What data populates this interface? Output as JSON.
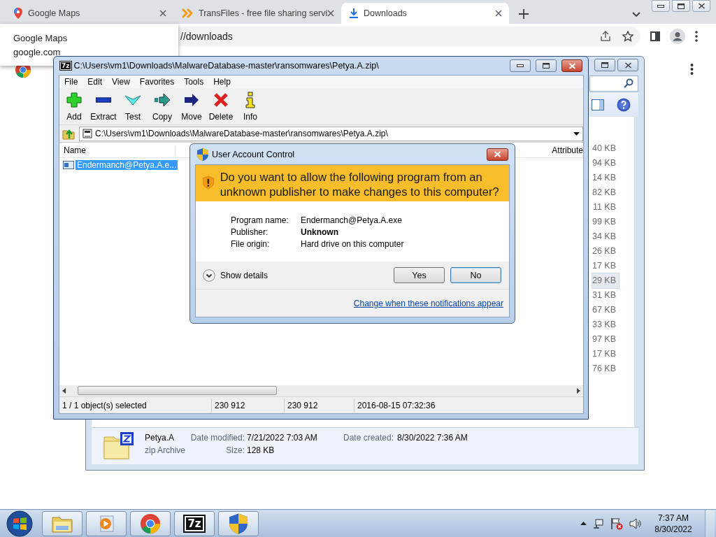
{
  "browser": {
    "tabs": [
      {
        "kind": "maps",
        "title": "Google Maps",
        "selected": false
      },
      {
        "kind": "transfer",
        "title": "TransFiles - free file sharing servi",
        "selected": false
      },
      {
        "kind": "download",
        "title": "Downloads",
        "selected": true
      }
    ],
    "tooltip": {
      "title": "Google Maps",
      "url": "google.com"
    },
    "address": "//downloads"
  },
  "explorer": {
    "sizes": [
      {
        "text": "40 KB",
        "selected": false
      },
      {
        "text": "94 KB",
        "selected": false
      },
      {
        "text": "14 KB",
        "selected": false
      },
      {
        "text": "82 KB",
        "selected": false
      },
      {
        "text": "11 KB",
        "selected": false
      },
      {
        "text": "99 KB",
        "selected": false
      },
      {
        "text": "34 KB",
        "selected": false
      },
      {
        "text": "26 KB",
        "selected": false
      },
      {
        "text": "17 KB",
        "selected": false
      },
      {
        "text": "29 KB",
        "selected": true
      },
      {
        "text": "31 KB",
        "selected": false
      },
      {
        "text": "67 KB",
        "selected": false
      },
      {
        "text": "33 KB",
        "selected": false
      },
      {
        "text": "97 KB",
        "selected": false
      },
      {
        "text": "17 KB",
        "selected": false
      },
      {
        "text": "76 KB",
        "selected": false
      }
    ],
    "details": {
      "name": "Petya.A",
      "type": "zip Archive",
      "fields": [
        {
          "label": "Date modified:",
          "value": "7/21/2022 7:03 AM"
        },
        {
          "label": "Size:",
          "value": "128 KB"
        },
        {
          "label": "Date created:",
          "value": "8/30/2022 7:36 AM"
        }
      ]
    }
  },
  "archiver": {
    "logo": "7z",
    "title": "C:\\Users\\vm1\\Downloads\\MalwareDatabase-master\\ransomwares\\Petya.A.zip\\",
    "menu": [
      "File",
      "Edit",
      "View",
      "Favorites",
      "Tools",
      "Help"
    ],
    "tools": [
      {
        "kind": "add",
        "label": "Add"
      },
      {
        "kind": "extract",
        "label": "Extract"
      },
      {
        "kind": "test",
        "label": "Test"
      },
      {
        "kind": "copy",
        "label": "Copy"
      },
      {
        "kind": "move",
        "label": "Move"
      },
      {
        "kind": "delete",
        "label": "Delete"
      },
      {
        "kind": "info",
        "label": "Info"
      }
    ],
    "path": "C:\\Users\\vm1\\Downloads\\MalwareDatabase-master\\ransomwares\\Petya.A.zip\\",
    "columns": [
      "Name",
      "Attribute"
    ],
    "files": [
      {
        "name": "Endermanch@Petya.A.e...",
        "selected": true
      }
    ],
    "status": [
      "1 / 1 object(s) selected",
      "230 912",
      "230 912",
      "2016-08-15 07:32:36"
    ]
  },
  "uac": {
    "title": "User Account Control",
    "question": "Do you want to allow the following program from an unknown publisher to make changes to this computer?",
    "fields": [
      {
        "label": "Program name:",
        "value": "Endermanch@Petya.A.exe",
        "bold": false
      },
      {
        "label": "Publisher:",
        "value": "Unknown",
        "bold": true
      },
      {
        "label": "File origin:",
        "value": "Hard drive on this computer",
        "bold": false
      }
    ],
    "details_toggle": "Show details",
    "buttons": [
      {
        "label": "Yes",
        "selected": false
      },
      {
        "label": "No",
        "selected": true
      }
    ],
    "link": "Change when these notifications appear"
  },
  "taskbar": {
    "apps": [
      {
        "kind": "explorer"
      },
      {
        "kind": "media"
      },
      {
        "kind": "chrome"
      },
      {
        "kind": "archiver",
        "label": "7z"
      },
      {
        "kind": "shield"
      }
    ],
    "time": "7:37 AM",
    "date": "8/30/2022"
  }
}
